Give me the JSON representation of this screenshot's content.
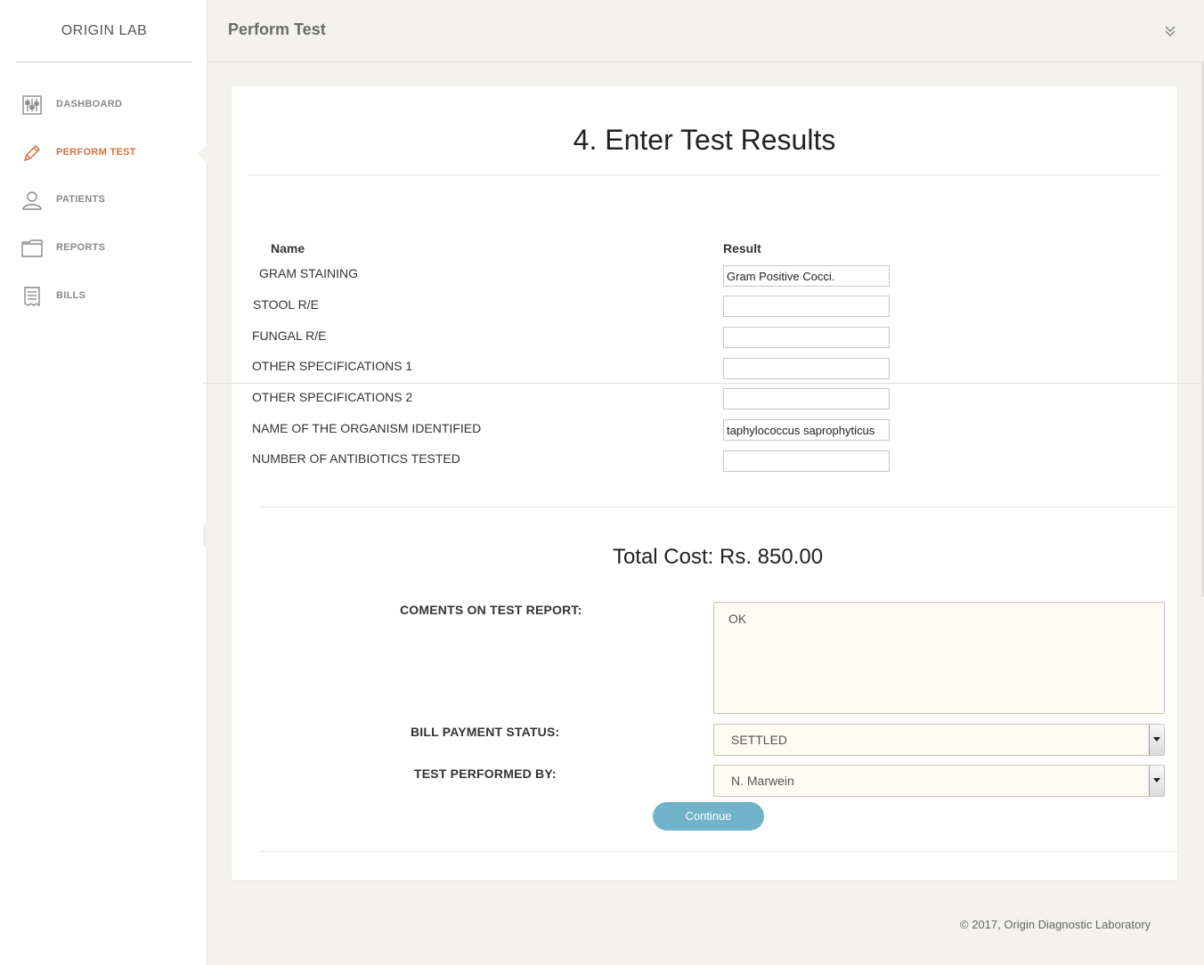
{
  "sidebar": {
    "brand": "ORIGIN LAB",
    "items": [
      {
        "label": "DASHBOARD",
        "icon": "dashboard-sliders-icon",
        "active": false
      },
      {
        "label": "PERFORM TEST",
        "icon": "pencil-icon",
        "active": true
      },
      {
        "label": "PATIENTS",
        "icon": "user-icon",
        "active": false
      },
      {
        "label": "REPORTS",
        "icon": "folder-icon",
        "active": false
      },
      {
        "label": "BILLS",
        "icon": "receipt-icon",
        "active": false
      }
    ]
  },
  "header": {
    "title": "Perform Test",
    "collapse_icon": "double-chevron-down-icon"
  },
  "main": {
    "step_title": "4. Enter Test Results",
    "columns": {
      "name": "Name",
      "result": "Result"
    },
    "tests": [
      {
        "name": "GRAM STAINING",
        "result": "Gram Positive Cocci."
      },
      {
        "name": "STOOL R/E",
        "result": ""
      },
      {
        "name": "FUNGAL R/E",
        "result": ""
      },
      {
        "name": "OTHER SPECIFICATIONS 1",
        "result": ""
      },
      {
        "name": "OTHER SPECIFICATIONS 2",
        "result": ""
      },
      {
        "name": "NAME OF THE ORGANISM IDENTIFIED",
        "result": "taphylococcus saprophyticus"
      },
      {
        "name": "NUMBER OF ANTIBIOTICS TESTED",
        "result": ""
      }
    ],
    "total_cost": "Total Cost: Rs. 850.00",
    "comments_label": "COMENTS ON TEST REPORT:",
    "comments_value": "OK",
    "bill_status_label": "BILL PAYMENT STATUS:",
    "bill_status_value": "SETTLED",
    "performed_by_label": "TEST PERFORMED BY:",
    "performed_by_value": "N. Marwein",
    "continue_label": "Continue"
  },
  "footer": {
    "text": "© 2017, Origin Diagnostic Laboratory"
  },
  "colors": {
    "accent_active": "#d9703f",
    "button": "#71b3c9",
    "field_bg": "#fdfbf2",
    "page_bg": "#f3f2ee"
  }
}
